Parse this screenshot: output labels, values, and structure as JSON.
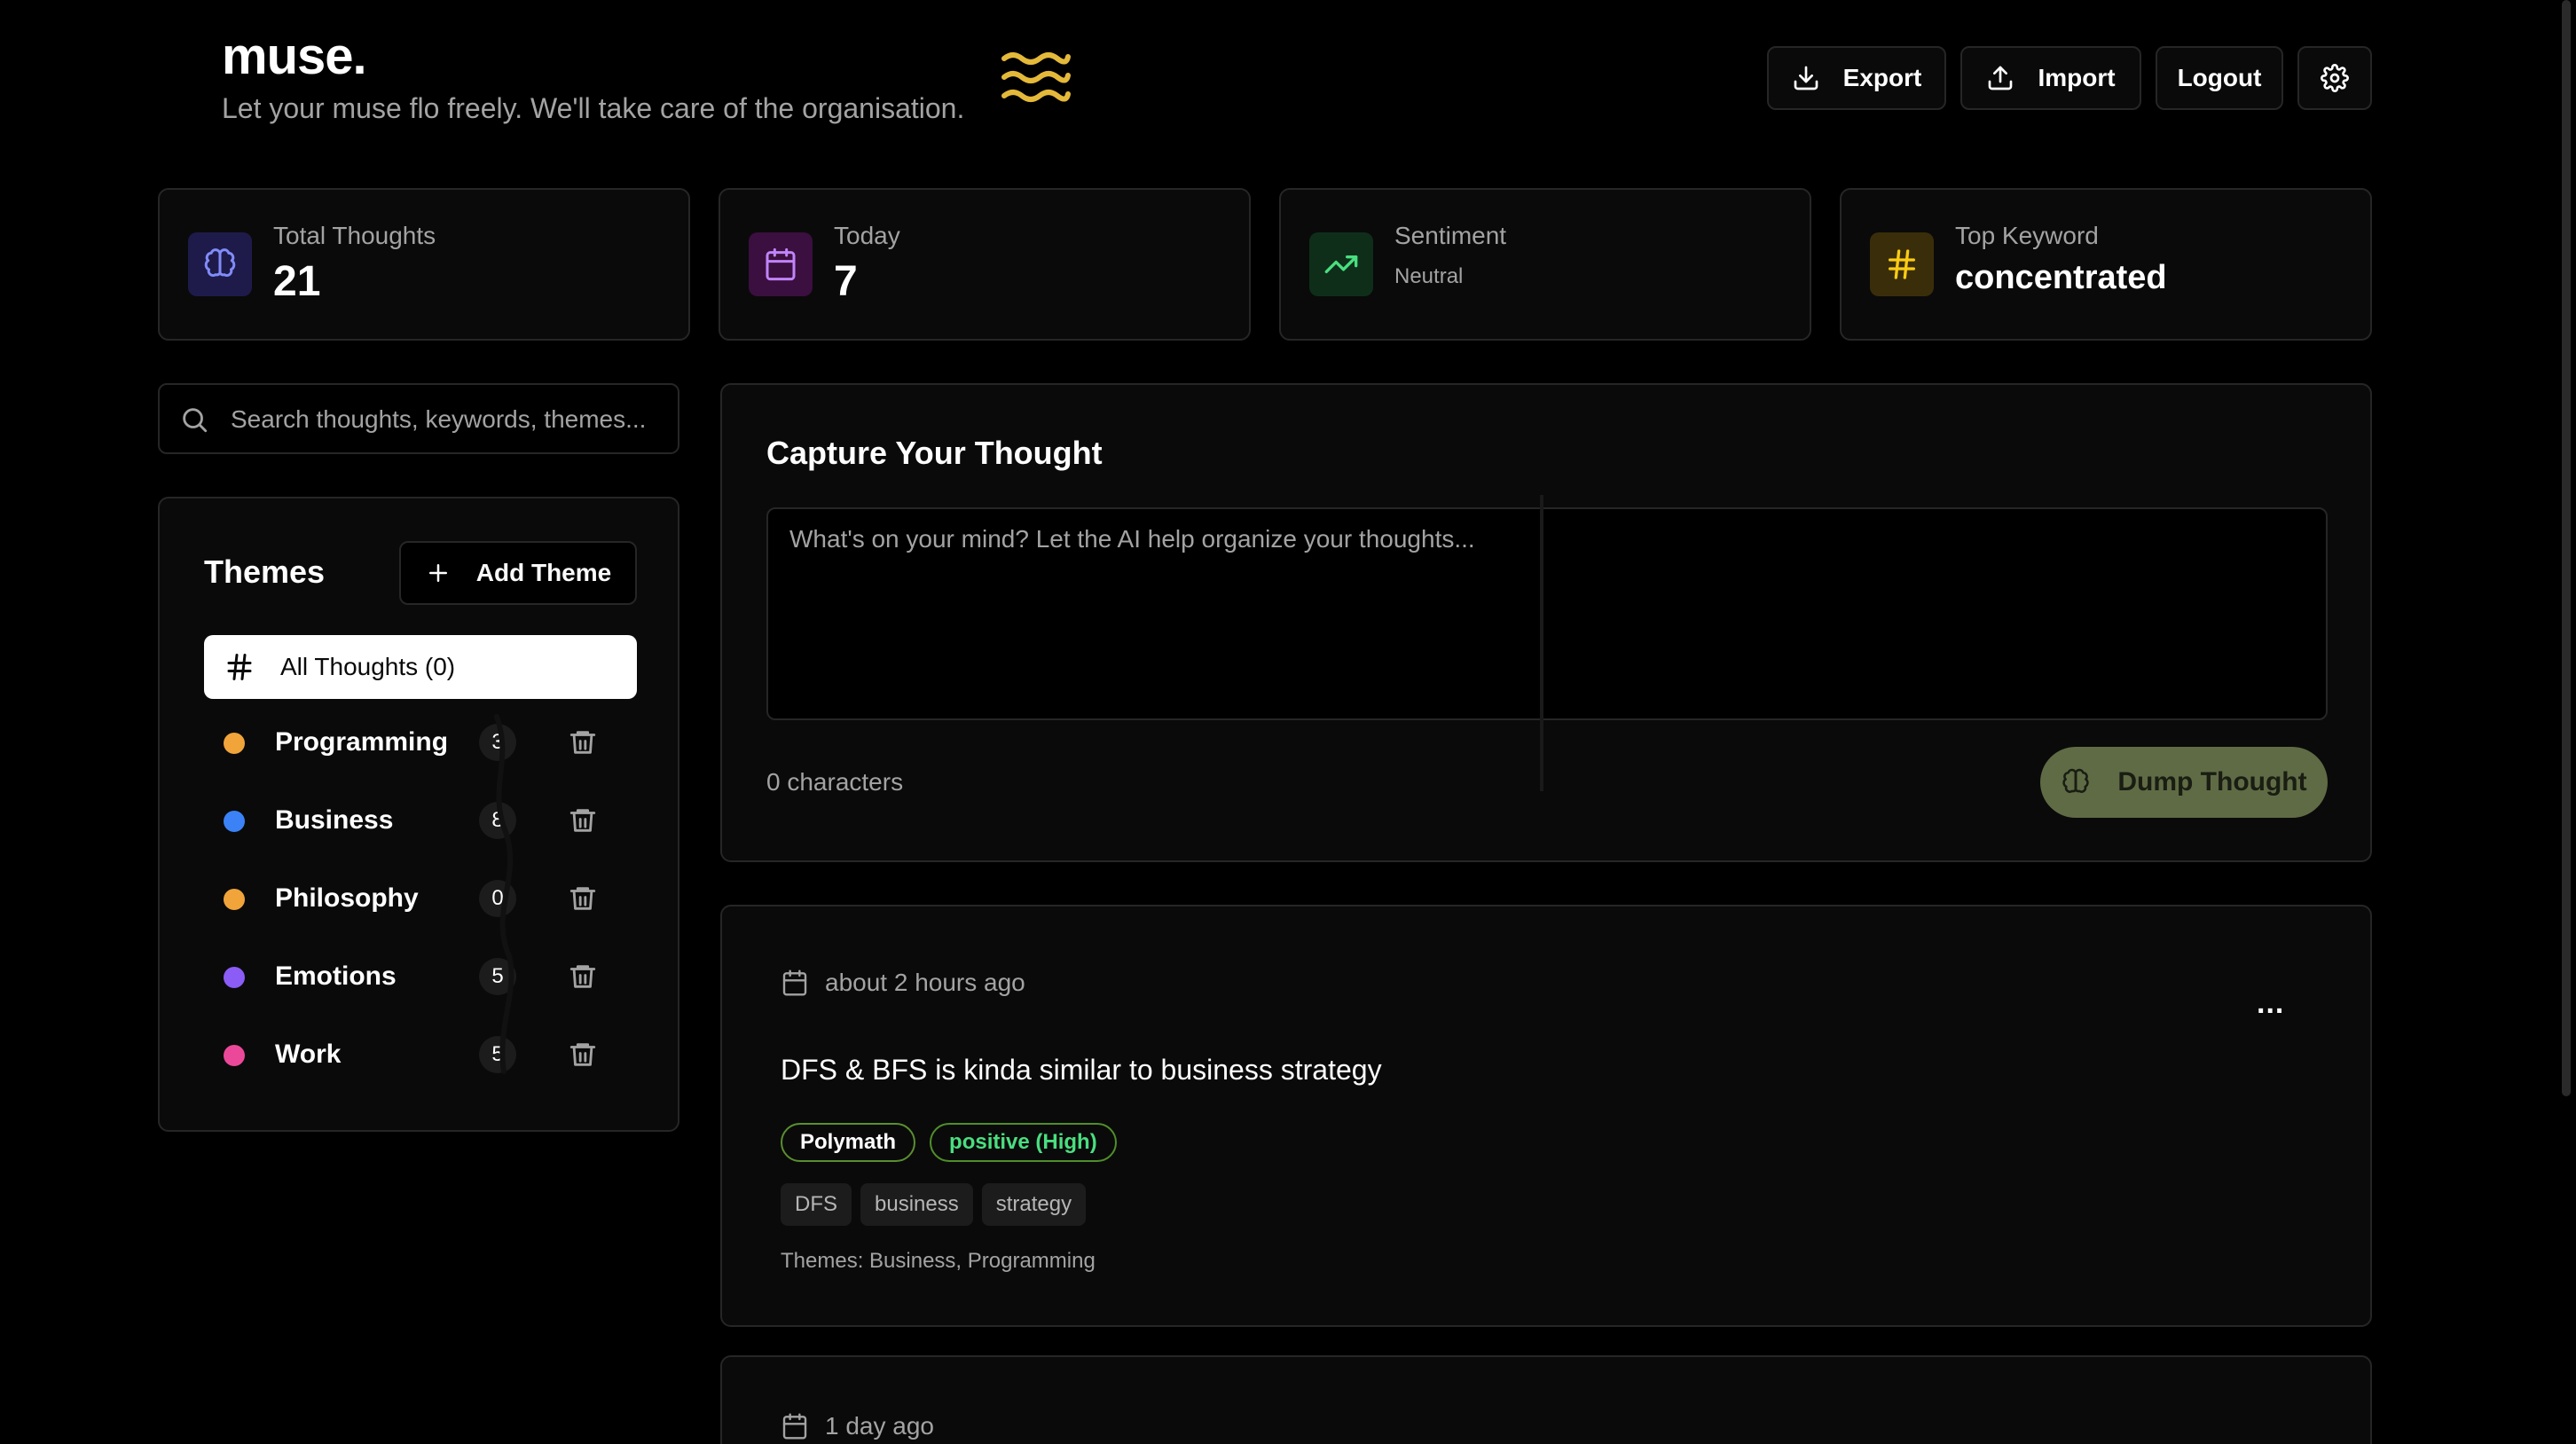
{
  "header": {
    "brand": "muse.",
    "tagline": "Let your muse flo freely. We'll take care of the organisation.",
    "buttons": {
      "export": "Export",
      "import": "Import",
      "logout": "Logout"
    }
  },
  "stats": {
    "total": {
      "label": "Total Thoughts",
      "value": "21"
    },
    "today": {
      "label": "Today",
      "value": "7"
    },
    "sentiment": {
      "label": "Sentiment",
      "value": "Neutral"
    },
    "keyword": {
      "label": "Top Keyword",
      "value": "concentrated"
    }
  },
  "search": {
    "placeholder": "Search thoughts, keywords, themes..."
  },
  "themes": {
    "title": "Themes",
    "add_label": "Add Theme",
    "all_label": "All Thoughts (0)",
    "items": [
      {
        "name": "Programming",
        "count": "3",
        "color": "#f0a43a"
      },
      {
        "name": "Business",
        "count": "8",
        "color": "#3b82f6"
      },
      {
        "name": "Philosophy",
        "count": "0",
        "color": "#f0a43a"
      },
      {
        "name": "Emotions",
        "count": "5",
        "color": "#8b5cf6"
      },
      {
        "name": "Work",
        "count": "5",
        "color": "#ec4899"
      }
    ]
  },
  "capture": {
    "title": "Capture Your Thought",
    "placeholder": "What's on your mind? Let the AI help organize your thoughts...",
    "char_count": "0 characters",
    "button": "Dump Thought"
  },
  "thoughts": [
    {
      "date": "about 2 hours ago",
      "more": "...",
      "text": "DFS & BFS is kinda similar to business strategy",
      "badges": [
        {
          "label": "Polymath",
          "color": "#ffffff",
          "border": "#5a8f2f"
        },
        {
          "label": "positive (High)",
          "color": "#4ade80",
          "border": "#4f8f2a"
        }
      ],
      "keywords": [
        "DFS",
        "business",
        "strategy"
      ],
      "themes_line": "Themes: Business, Programming"
    },
    {
      "date": "1 day ago",
      "more": "..."
    }
  ],
  "colors": {
    "accent_wave": "#e4b93a",
    "brain_bg": "#1e1b4b",
    "brain": "#818cf8",
    "calendar_bg": "#3b0f3f",
    "calendar": "#c084fc",
    "trend_bg": "#0f2e1a",
    "trend": "#4ade80",
    "hash_bg": "#3a2e0a",
    "hash": "#facc15",
    "dump_button": "#5f6b45"
  }
}
